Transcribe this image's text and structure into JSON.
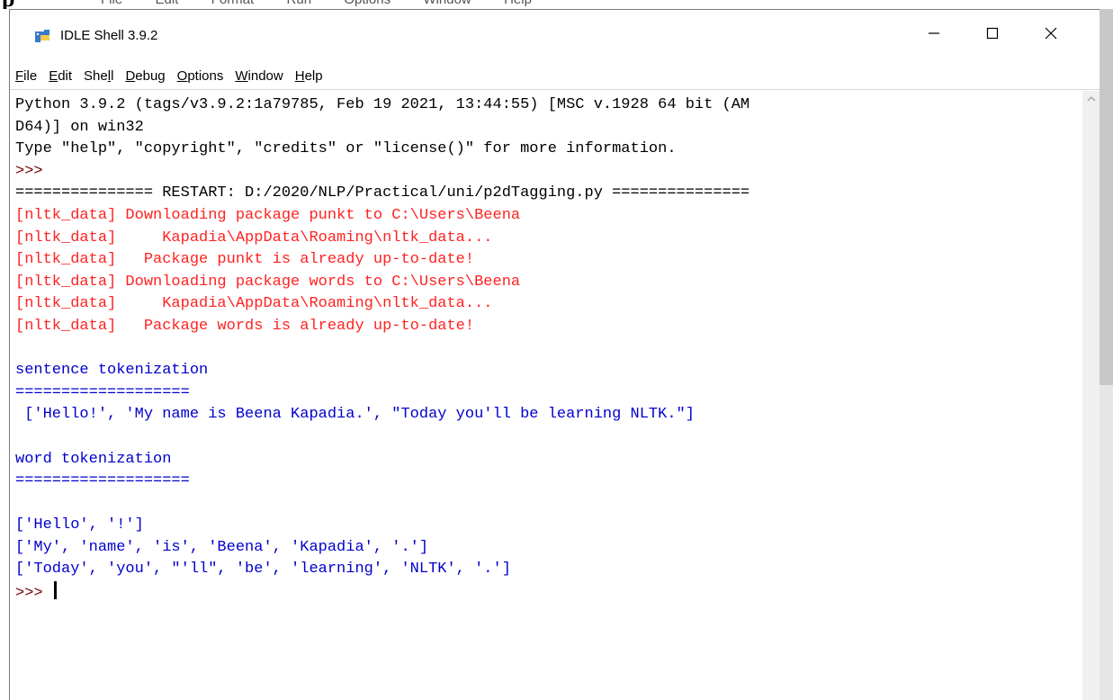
{
  "behind": {
    "fragment_p": "p",
    "menu_fragment": "File  Edit  Format  Run  Options  Window  Help"
  },
  "window": {
    "title": "IDLE Shell 3.9.2",
    "icon": "python-idle-icon",
    "controls": {
      "minimize": "minimize-icon",
      "maximize": "maximize-icon",
      "close": "close-icon"
    }
  },
  "menu": [
    {
      "pre": "",
      "u": "F",
      "post": "ile"
    },
    {
      "pre": "",
      "u": "E",
      "post": "dit"
    },
    {
      "pre": "She",
      "u": "l",
      "post": "l"
    },
    {
      "pre": "",
      "u": "D",
      "post": "ebug"
    },
    {
      "pre": "",
      "u": "O",
      "post": "ptions"
    },
    {
      "pre": "",
      "u": "W",
      "post": "indow"
    },
    {
      "pre": "",
      "u": "H",
      "post": "elp"
    }
  ],
  "colors": {
    "stderr": "#ff2222",
    "stdout": "#0000cc",
    "prompt": "#770000"
  },
  "shell": {
    "lines": [
      {
        "text": "Python 3.9.2 (tags/v3.9.2:1a79785, Feb 19 2021, 13:44:55) [MSC v.1928 64 bit (AM",
        "style": "out"
      },
      {
        "text": "D64)] on win32",
        "style": "out"
      },
      {
        "text": "Type \"help\", \"copyright\", \"credits\" or \"license()\" for more information.",
        "style": "out"
      },
      {
        "text": ">>> ",
        "style": "prompt"
      },
      {
        "text": "=============== RESTART: D:/2020/NLP/Practical/uni/p2dTagging.py ===============",
        "style": "restart"
      },
      {
        "text": "[nltk_data] Downloading package punkt to C:\\Users\\Beena",
        "style": "err"
      },
      {
        "text": "[nltk_data]     Kapadia\\AppData\\Roaming\\nltk_data...",
        "style": "err"
      },
      {
        "text": "[nltk_data]   Package punkt is already up-to-date!",
        "style": "err"
      },
      {
        "text": "[nltk_data] Downloading package words to C:\\Users\\Beena",
        "style": "err"
      },
      {
        "text": "[nltk_data]     Kapadia\\AppData\\Roaming\\nltk_data...",
        "style": "err"
      },
      {
        "text": "[nltk_data]   Package words is already up-to-date!",
        "style": "err"
      },
      {
        "text": "",
        "style": "blue"
      },
      {
        "text": "sentence tokenization",
        "style": "blue"
      },
      {
        "text": "===================",
        "style": "blue"
      },
      {
        "text": " ['Hello!', 'My name is Beena Kapadia.', \"Today you'll be learning NLTK.\"]",
        "style": "blue"
      },
      {
        "text": "",
        "style": "blue"
      },
      {
        "text": "word tokenization",
        "style": "blue"
      },
      {
        "text": "===================",
        "style": "blue"
      },
      {
        "text": "",
        "style": "blue"
      },
      {
        "text": "['Hello', '!']",
        "style": "blue"
      },
      {
        "text": "['My', 'name', 'is', 'Beena', 'Kapadia', '.']",
        "style": "blue"
      },
      {
        "text": "['Today', 'you', \"'ll\", 'be', 'learning', 'NLTK', '.']",
        "style": "blue"
      }
    ],
    "final_prompt": ">>> "
  }
}
